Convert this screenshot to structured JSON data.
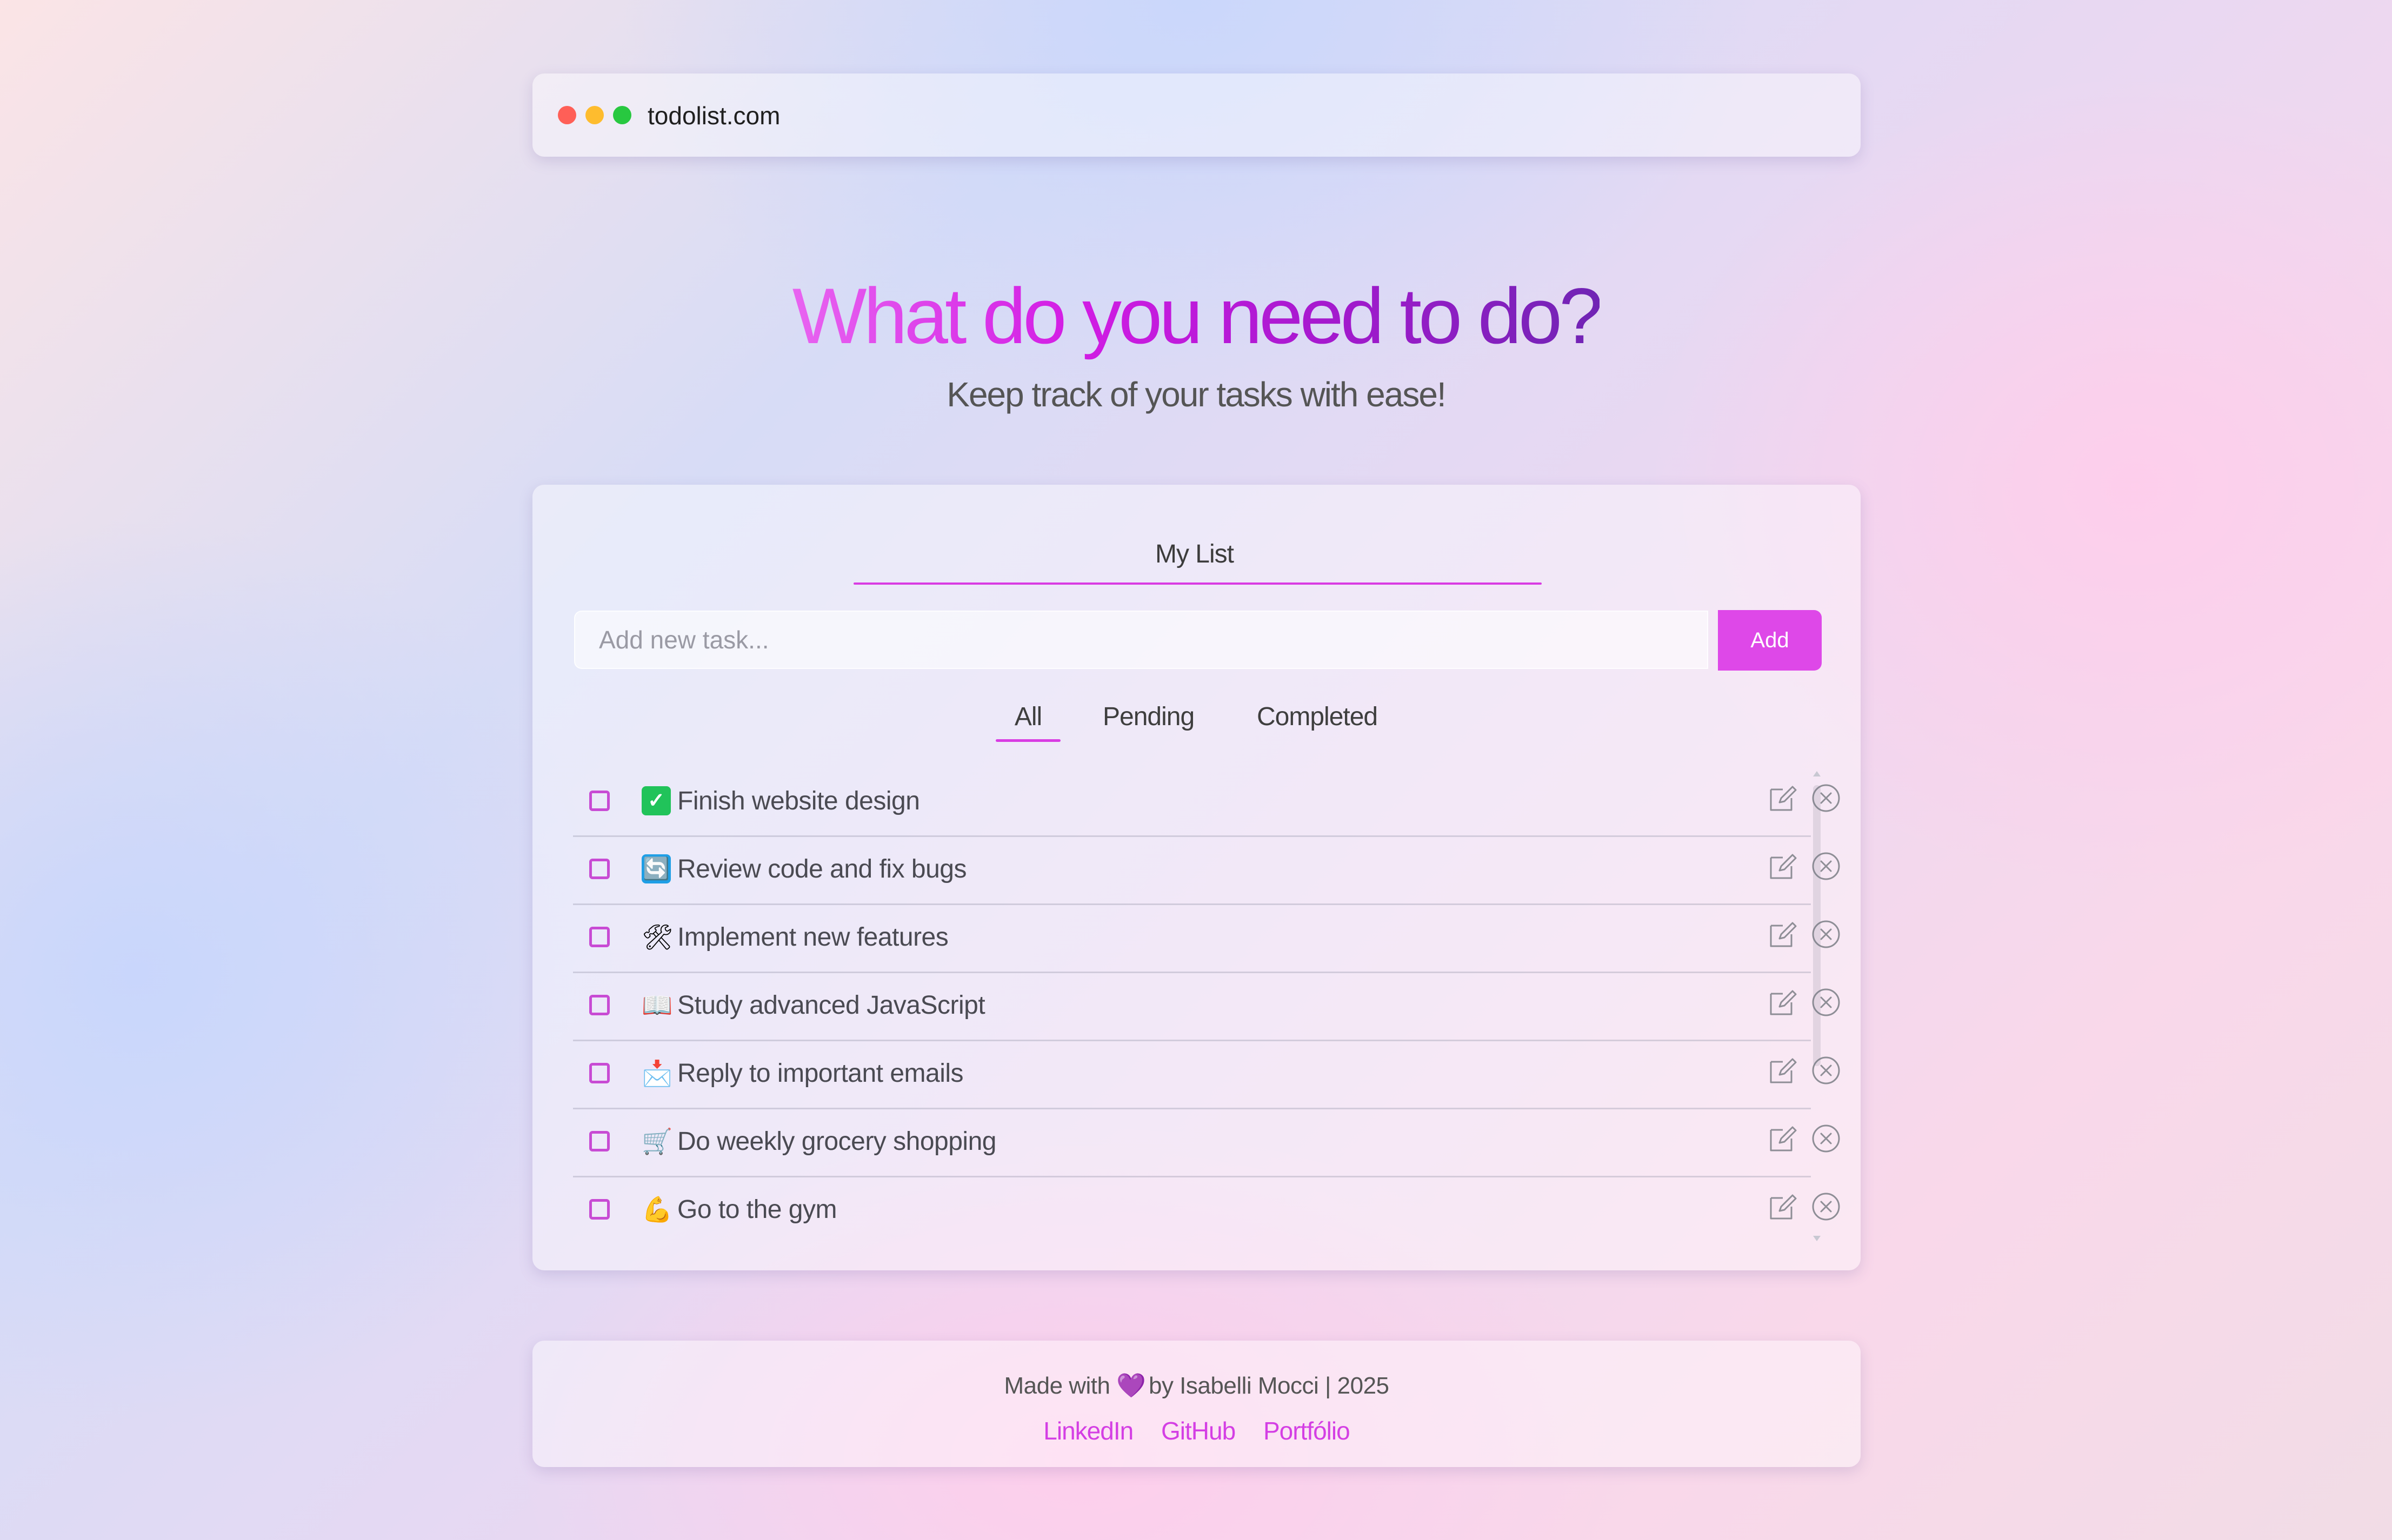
{
  "browser": {
    "url": "todolist.com"
  },
  "hero": {
    "title": "What do you need to do?",
    "subtitle": "Keep track of your tasks with ease!"
  },
  "list": {
    "title": "My List",
    "input_placeholder": "Add new task...",
    "add_label": "Add",
    "tabs": [
      {
        "label": "All",
        "active": true
      },
      {
        "label": "Pending",
        "active": false
      },
      {
        "label": "Completed",
        "active": false
      }
    ],
    "tasks": [
      {
        "icon": "check-mark-button-emoji",
        "emoji": "✓",
        "text": "Finish website design",
        "completed": false
      },
      {
        "icon": "refresh-arrows-emoji",
        "emoji": "🔄",
        "text": "Review code and fix bugs",
        "completed": false
      },
      {
        "icon": "hammer-and-wrench-emoji",
        "emoji": "🛠",
        "text": "Implement new features",
        "completed": false
      },
      {
        "icon": "open-book-emoji",
        "emoji": "📖",
        "text": "Study advanced JavaScript",
        "completed": false
      },
      {
        "icon": "envelope-arrow-emoji",
        "emoji": "📩",
        "text": "Reply to important emails",
        "completed": false
      },
      {
        "icon": "shopping-cart-emoji",
        "emoji": "🛒",
        "text": "Do weekly grocery shopping",
        "completed": false
      },
      {
        "icon": "flexed-biceps-emoji",
        "emoji": "💪",
        "text": "Go to the gym",
        "completed": false
      }
    ]
  },
  "footer": {
    "made_prefix": "Made with",
    "heart": "💜",
    "made_suffix": "by Isabelli Mocci | 2025",
    "links": [
      "LinkedIn",
      "GitHub",
      "Portfólio"
    ]
  },
  "colors": {
    "accent": "#de48e8",
    "title_gradient": [
      "#e864f0",
      "#d21ce4",
      "#a719cf",
      "#7024b4"
    ],
    "traffic_lights": [
      "#ff5f57",
      "#febc2e",
      "#28c840"
    ]
  }
}
